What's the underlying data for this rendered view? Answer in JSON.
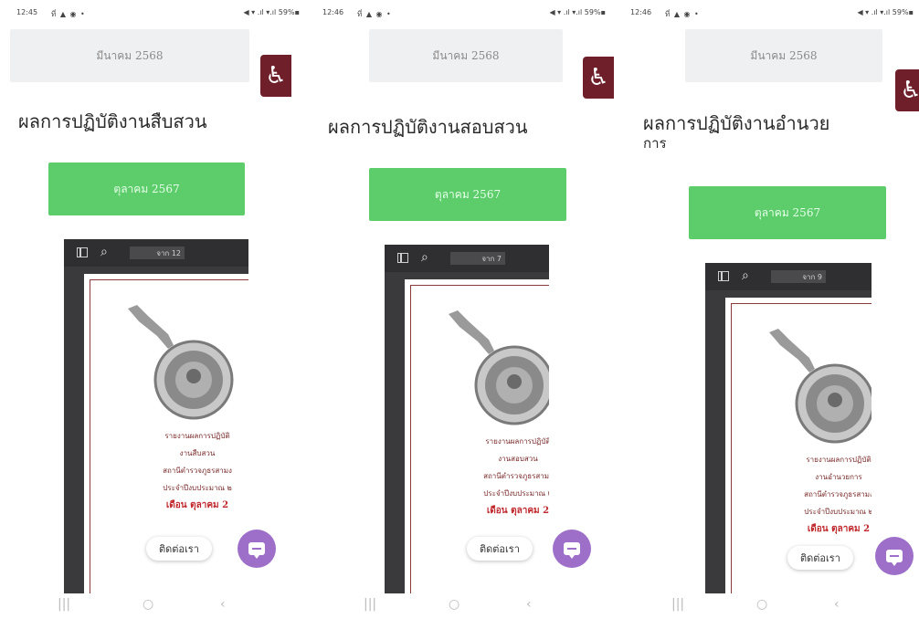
{
  "screens": [
    {
      "status": {
        "time": "12:45",
        "icons": "ที่ ▲ ◉ •",
        "right": "◀ ▾ .ıl ▾.ıl 59%▪"
      },
      "month_box": "มีนาคม 2568",
      "title": "ผลการปฏิบัติงานสืบสวน",
      "green_button": "ตุลาคม 2567",
      "viewer_page": "จาก 12",
      "doc_lines": [
        "รายงานผลการปฏิบัติ",
        "งานสืบสวน",
        "สถานีตำรวจภูธรสามง",
        "ประจำปีงบประมาณ ๒",
        "เดือน ตุลาคม 2"
      ],
      "contact_label": "ติดต่อเรา"
    },
    {
      "status": {
        "time": "12:46",
        "icons": "ที่ ▲ ◉ •",
        "right": "◀ ▾ .ıl ▾.ıl 59%▪"
      },
      "month_box": "มีนาคม 2568",
      "title": "ผลการปฏิบัติงานสอบสวน",
      "green_button": "ตุลาคม 2567",
      "viewer_page": "จาก 7",
      "doc_lines": [
        "รายงานผลการปฏิบัติ",
        "งานสอบสวน",
        "สถานีตำรวจภูธรสามง",
        "ประจำปีงบประมาณ ๒",
        "เดือน ตุลาคม 2"
      ],
      "contact_label": "ติดต่อเรา"
    },
    {
      "status": {
        "time": "12:46",
        "icons": "ที่ ▲ ◉ •",
        "right": "◀ ▾ .ıl ▾.ıl 59%▪"
      },
      "month_box": "มีนาคม 2568",
      "title_line1": "ผลการปฏิบัติงานอำนวย",
      "title_line2": "การ",
      "green_button": "ตุลาคม 2567",
      "viewer_page": "จาก 9",
      "doc_lines": [
        "รายงานผลการปฏิบัติ",
        "งานอำนวยการ",
        "สถานีตำรวจภูธรสามง",
        "ประจำปีงบประมาณ ๒",
        "เดือน ตุลาคม 2"
      ],
      "contact_label": "ติดต่อเรา"
    }
  ],
  "nav": {
    "recents": "|||",
    "home": "○",
    "back": "‹"
  },
  "icons": {
    "accessibility": "wheelchair-icon",
    "chat": "chat-bubble-icon",
    "sidebar": "sidebar-toggle-icon",
    "search": "search-icon"
  },
  "colors": {
    "accent_green": "#5ccd6a",
    "accessibility_bg": "#6e1f2a",
    "chat_bg": "#9d6fc9"
  }
}
